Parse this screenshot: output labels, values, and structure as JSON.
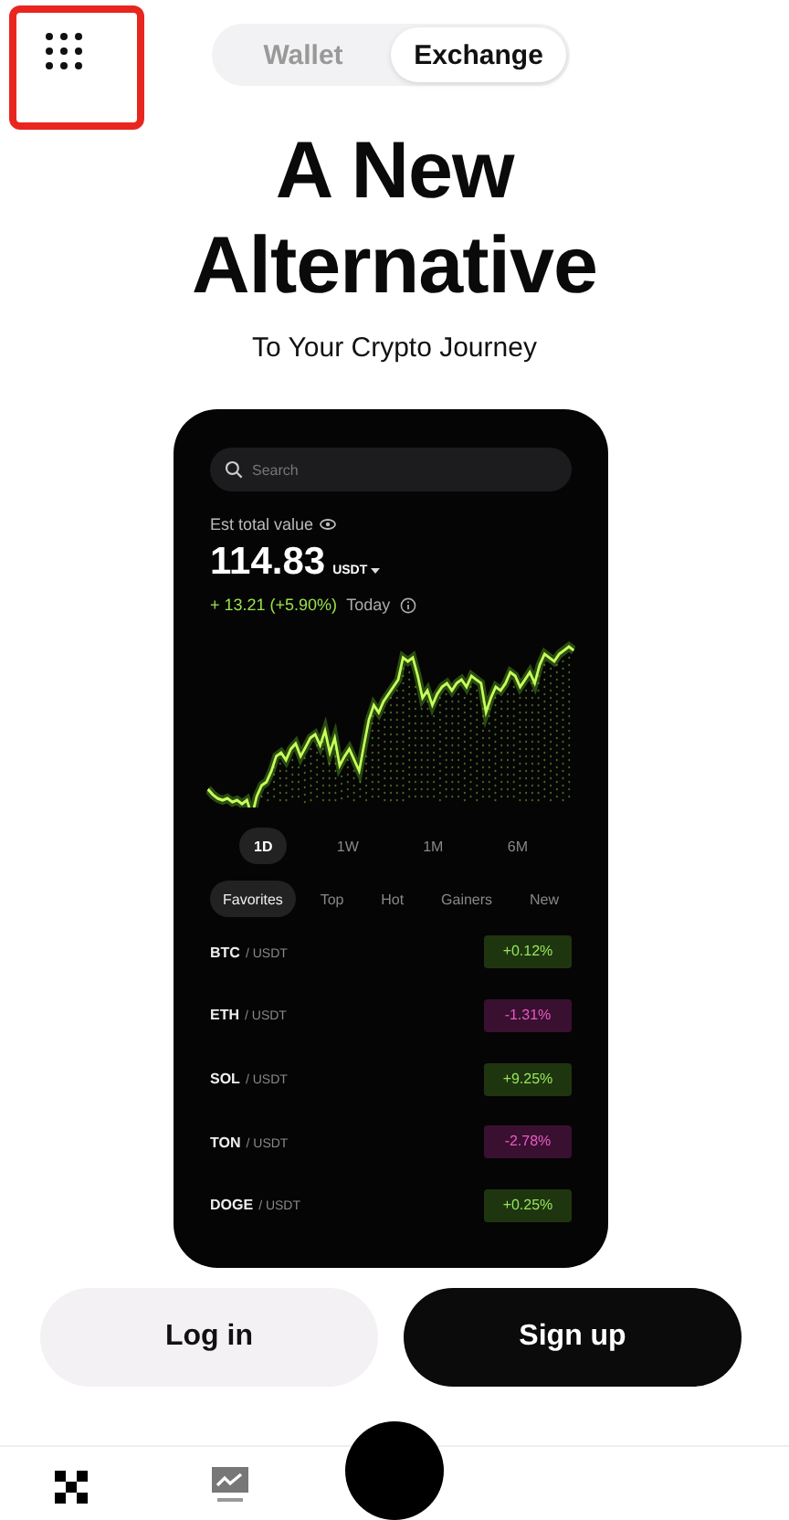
{
  "tabs": [
    {
      "label": "Wallet",
      "selected": false
    },
    {
      "label": "Exchange",
      "selected": true
    }
  ],
  "hero": {
    "title": "A New Alternative",
    "subtitle": "To Your Crypto Journey"
  },
  "phone": {
    "search": {
      "placeholder": "Search"
    },
    "balance": {
      "label": "Est total value",
      "amount": "114.83",
      "currency": "USDT",
      "change": "+ 13.21 (+5.90%)",
      "period": "Today"
    },
    "timeframes": [
      {
        "label": "1D",
        "selected": true
      },
      {
        "label": "1W",
        "selected": false
      },
      {
        "label": "1M",
        "selected": false
      },
      {
        "label": "6M",
        "selected": false
      }
    ],
    "market_tabs": [
      {
        "label": "Favorites",
        "selected": true
      },
      {
        "label": "Top",
        "selected": false
      },
      {
        "label": "Hot",
        "selected": false
      },
      {
        "label": "Gainers",
        "selected": false
      },
      {
        "label": "New",
        "selected": false
      }
    ],
    "pairs": [
      {
        "base": "BTC",
        "quote": "/ USDT",
        "change": "+0.12%",
        "color": "#1f3510"
      },
      {
        "base": "ETH",
        "quote": "/ USDT",
        "change": "-1.31%",
        "color": "#3a1030"
      },
      {
        "base": "SOL",
        "quote": "/ USDT",
        "change": "+9.25%",
        "color": "#1f3510"
      },
      {
        "base": "TON",
        "quote": "/ USDT",
        "change": "-2.78%",
        "color": "#3a1030"
      },
      {
        "base": "DOGE",
        "quote": "/ USDT",
        "change": "+0.25%",
        "color": "#1f3510"
      }
    ]
  },
  "actions": [
    {
      "label": "Log in",
      "kind": "secondary"
    },
    {
      "label": "Sign up",
      "kind": "primary"
    }
  ]
}
